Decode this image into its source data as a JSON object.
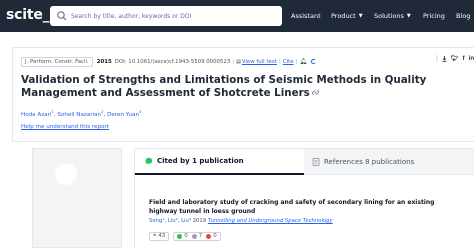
{
  "header": {
    "logo": "scite_",
    "search_placeholder": "Search by title, author, keywords or DOI",
    "nav": [
      {
        "label": "Assistant",
        "caret": false
      },
      {
        "label": "Product",
        "caret": true
      },
      {
        "label": "Solutions",
        "caret": true
      },
      {
        "label": "Pricing",
        "caret": false
      },
      {
        "label": "Blog",
        "caret": false
      }
    ]
  },
  "paper": {
    "journal": "J. Perform. Constr. Facil.",
    "year": "2015",
    "doi": "DOI: 10.1061/(asce)cf.1943-5509.0000523",
    "full_text_label": "View full text",
    "cite_label": "Cite",
    "title": "Validation of Strengths and Limitations of Seismic Methods in Quality Management and Assessment of Shotcrete Liners",
    "authors": [
      {
        "name": "Hoda Azari",
        "sup": "1"
      },
      {
        "name": "Soheil Nazarian",
        "sup": "2"
      },
      {
        "name": "Deren Yuan",
        "sup": "3"
      }
    ],
    "help_link": "Help me understand this report"
  },
  "tabs": {
    "cited_by": "Cited by 1 publication",
    "references": "References 8 publications"
  },
  "citation": {
    "title": "Field and laboratory study of cracking and safety of secondary lining for an existing highway tunnel in loess ground",
    "authors": "Song¹, Liu², Liu³",
    "year": "2019",
    "journal": "Tunnelling and Underground Space Technology",
    "stats": {
      "total": "43",
      "supporting": "0",
      "mentioning": "7",
      "contrasting": "0"
    }
  },
  "colors": {
    "header_bg": "#1f2937",
    "link": "#2563eb",
    "supporting": "#22c55e",
    "mentioning": "#9ca3af",
    "contrasting": "#ef4444"
  }
}
